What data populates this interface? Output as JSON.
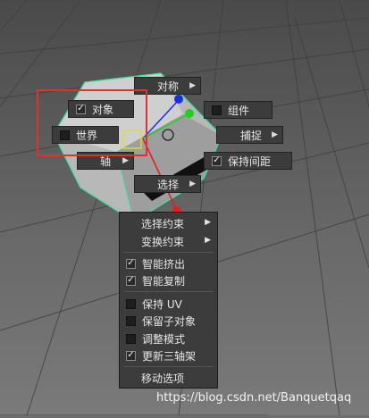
{
  "marking_menu": {
    "symmetry_label": "对称",
    "object_label": "对象",
    "object_checked": true,
    "component_label": "组件",
    "component_checked": false,
    "world_label": "世界",
    "world_checked": false,
    "snap_label": "捕捉",
    "axis_label": "轴",
    "keep_spacing_label": "保持间距",
    "keep_spacing_checked": true,
    "select_label": "选择"
  },
  "dropdown": {
    "items": [
      {
        "label": "选择约束",
        "submenu": true
      },
      {
        "label": "变换约束",
        "submenu": true
      },
      {
        "label": "智能挤出",
        "checked": true
      },
      {
        "label": "智能复制",
        "checked": true
      },
      {
        "label": "保持 UV",
        "checked": false
      },
      {
        "label": "保留子对象",
        "checked": false
      },
      {
        "label": "调整模式",
        "checked": false
      },
      {
        "label": "更新三轴架",
        "checked": true
      },
      {
        "label": "移动选项"
      }
    ]
  },
  "watermark": "https://blog.csdn.net/Banquetqaq",
  "colors": {
    "highlight_border": "#e03030",
    "x_axis": "#e02020",
    "y_axis": "#20d020",
    "z_axis": "#2030e0",
    "selection_edge": "#40e0a0"
  }
}
